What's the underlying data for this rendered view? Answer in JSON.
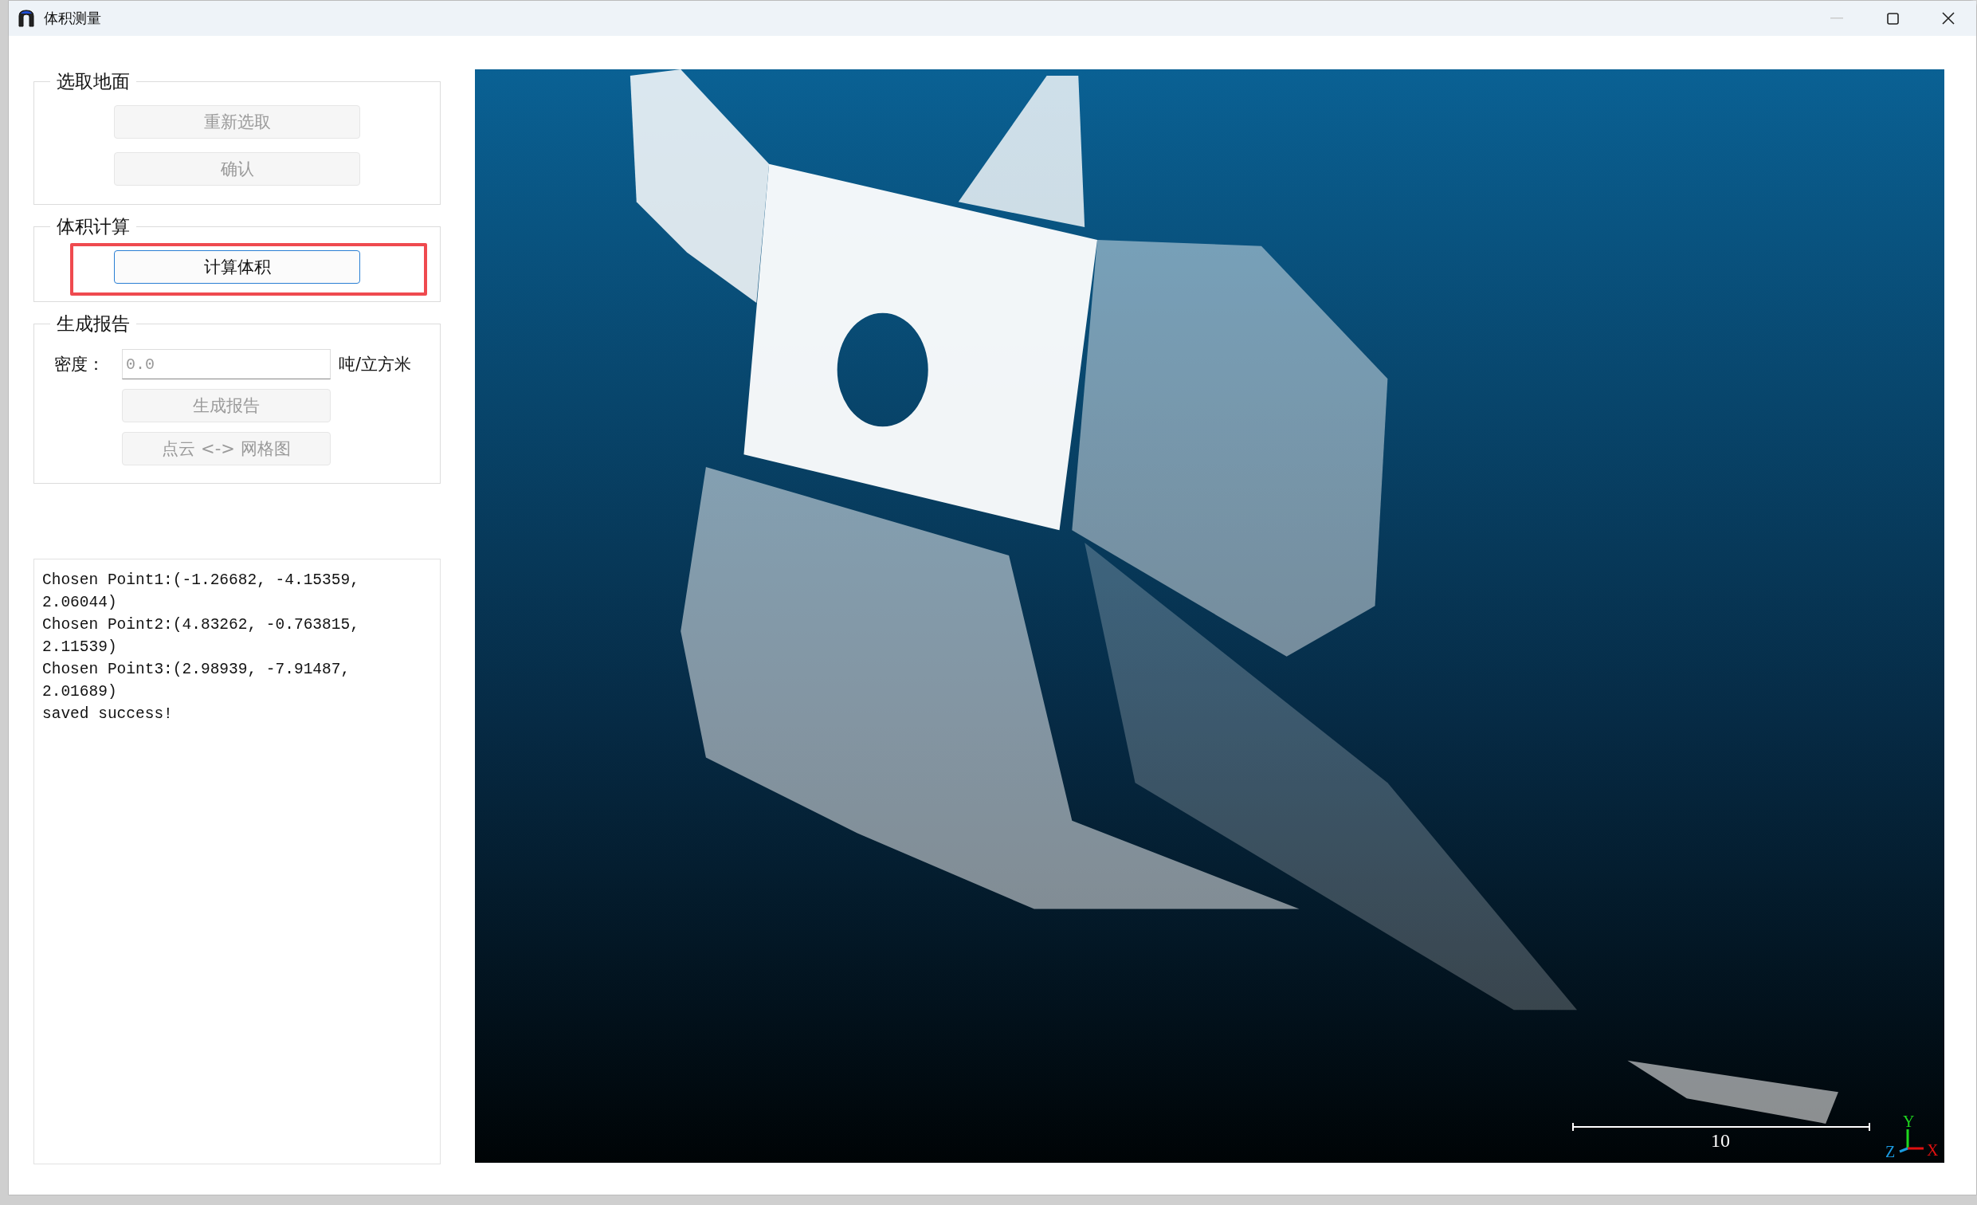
{
  "window": {
    "title": "体积测量",
    "minimize_disabled": true
  },
  "select_ground": {
    "title": "选取地面",
    "buttons": [
      {
        "label": "重新选取",
        "disabled": true
      },
      {
        "label": "确认",
        "disabled": true
      }
    ]
  },
  "volume_calc": {
    "title": "体积计算",
    "button": {
      "label": "计算体积",
      "disabled": false,
      "focused": true,
      "annotated": true
    }
  },
  "report": {
    "title": "生成报告",
    "density_label": "密度：",
    "density_placeholder": "0.0",
    "unit": "吨/立方米",
    "buttons": [
      {
        "label": "生成报告",
        "disabled": true
      },
      {
        "label": "点云 <-> 网格图",
        "disabled": true
      }
    ]
  },
  "log": [
    "Chosen Point1:(-1.26682, -4.15359,",
    "2.06044)",
    "Chosen Point2:(4.83262, -0.763815,",
    "2.11539)",
    "Chosen Point3:(2.98939, -7.91487,",
    "2.01689)",
    "saved success!"
  ],
  "viewer": {
    "scale_label": "10",
    "axes": {
      "x": "X",
      "y": "Y",
      "z": "Z"
    }
  }
}
